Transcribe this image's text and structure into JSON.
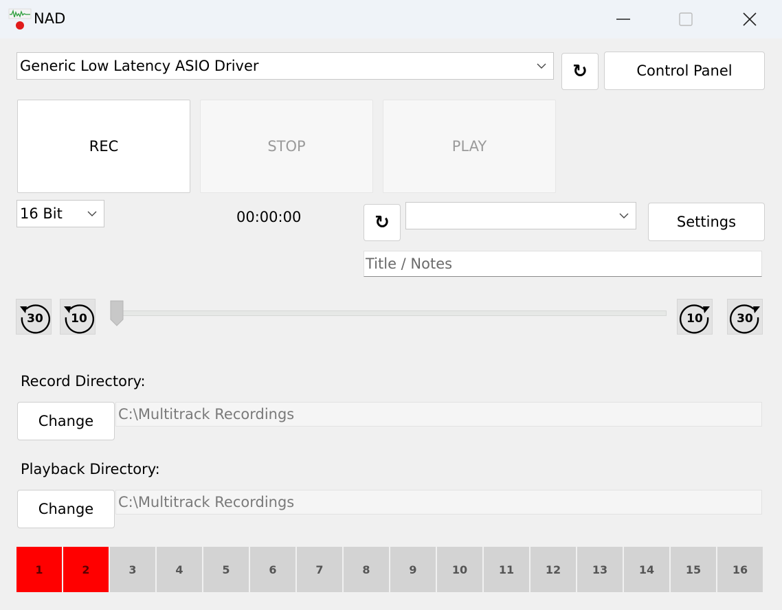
{
  "window": {
    "title": "NAD",
    "icon": "app-waveform-rec-icon"
  },
  "driver": {
    "selected": "Generic Low Latency ASIO Driver",
    "control_panel_label": "Control Panel",
    "refresh_glyph": "↻"
  },
  "transport": {
    "rec_label": "REC",
    "stop_label": "STOP",
    "play_label": "PLAY",
    "time": "00:00:00"
  },
  "format": {
    "bit_depth": "16 Bit"
  },
  "playback": {
    "refresh_glyph": "↻",
    "file_selected": "",
    "settings_label": "Settings",
    "title_placeholder": "Title / Notes"
  },
  "seek": {
    "back30": "30",
    "back10": "10",
    "fwd10": "10",
    "fwd30": "30",
    "position": 0
  },
  "record_dir": {
    "label": "Record Directory:",
    "change_label": "Change",
    "path": "C:\\Multitrack Recordings"
  },
  "playback_dir": {
    "label": "Playback Directory:",
    "change_label": "Change",
    "path": "C:\\Multitrack Recordings"
  },
  "channels": [
    {
      "label": "1",
      "active": true
    },
    {
      "label": "2",
      "active": true
    },
    {
      "label": "3",
      "active": false
    },
    {
      "label": "4",
      "active": false
    },
    {
      "label": "5",
      "active": false
    },
    {
      "label": "6",
      "active": false
    },
    {
      "label": "7",
      "active": false
    },
    {
      "label": "8",
      "active": false
    },
    {
      "label": "9",
      "active": false
    },
    {
      "label": "10",
      "active": false
    },
    {
      "label": "11",
      "active": false
    },
    {
      "label": "12",
      "active": false
    },
    {
      "label": "13",
      "active": false
    },
    {
      "label": "14",
      "active": false
    },
    {
      "label": "15",
      "active": false
    },
    {
      "label": "16",
      "active": false
    }
  ],
  "colors": {
    "channel_active": "#ff0000",
    "channel_inactive": "#d3d3d3",
    "titlebar": "#eff3f8"
  }
}
